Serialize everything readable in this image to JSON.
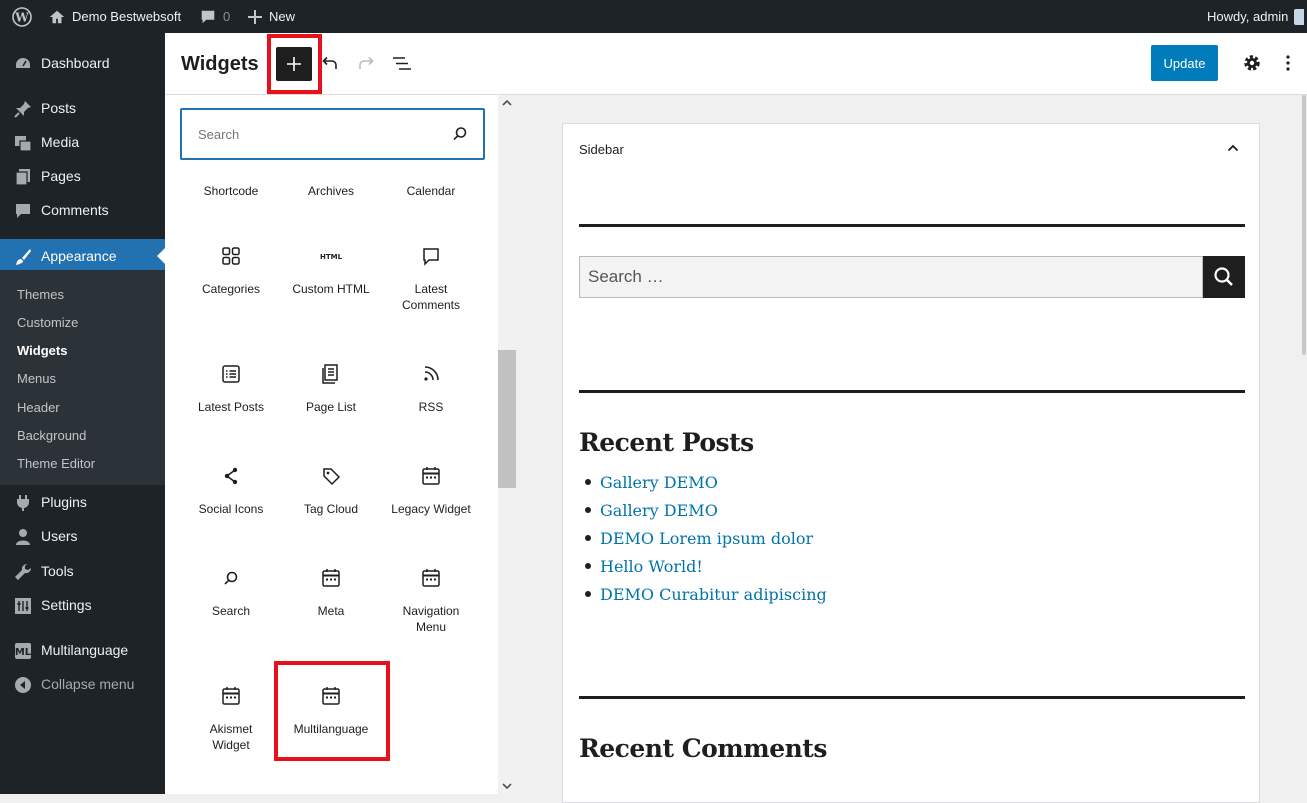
{
  "admin_bar": {
    "site_name": "Demo Bestwebsoft",
    "comments_count": "0",
    "new_label": "New",
    "greeting": "Howdy, admin"
  },
  "sidebar": {
    "items": [
      {
        "key": "dashboard",
        "label": "Dashboard",
        "icon": "dashboard-icon"
      },
      {
        "key": "posts",
        "label": "Posts",
        "icon": "pushpin-icon"
      },
      {
        "key": "media",
        "label": "Media",
        "icon": "media-icon"
      },
      {
        "key": "pages",
        "label": "Pages",
        "icon": "pages-icon"
      },
      {
        "key": "comments",
        "label": "Comments",
        "icon": "comments-icon"
      },
      {
        "key": "appearance",
        "label": "Appearance",
        "icon": "paintbrush-icon"
      },
      {
        "key": "plugins",
        "label": "Plugins",
        "icon": "plugins-icon"
      },
      {
        "key": "users",
        "label": "Users",
        "icon": "users-icon"
      },
      {
        "key": "tools",
        "label": "Tools",
        "icon": "wrench-icon"
      },
      {
        "key": "settings",
        "label": "Settings",
        "icon": "settings-icon"
      },
      {
        "key": "multilanguage",
        "label": "Multilanguage",
        "icon": "multilanguage-icon"
      },
      {
        "key": "collapse",
        "label": "Collapse menu",
        "icon": "collapse-icon"
      }
    ],
    "submenu": [
      "Themes",
      "Customize",
      "Widgets",
      "Menus",
      "Header",
      "Background",
      "Theme Editor"
    ],
    "active": "Appearance",
    "current_submenu": "Widgets"
  },
  "header": {
    "title": "Widgets",
    "update_label": "Update"
  },
  "inserter": {
    "search_placeholder": "Search",
    "blocks": [
      {
        "label": "Shortcode"
      },
      {
        "label": "Archives"
      },
      {
        "label": "Calendar"
      },
      {
        "label": "Categories",
        "icon": "grid-icon"
      },
      {
        "label": "Custom HTML",
        "icon": "html-icon",
        "icon_text": "HTML"
      },
      {
        "label": "Latest Comments",
        "icon": "comment-icon"
      },
      {
        "label": "Latest Posts",
        "icon": "post-list-icon"
      },
      {
        "label": "Page List",
        "icon": "page-list-icon"
      },
      {
        "label": "RSS",
        "icon": "rss-icon"
      },
      {
        "label": "Social Icons",
        "icon": "share-icon"
      },
      {
        "label": "Tag Cloud",
        "icon": "tag-icon"
      },
      {
        "label": "Legacy Widget",
        "icon": "calendar-icon"
      },
      {
        "label": "Search",
        "icon": "search-icon"
      },
      {
        "label": "Meta",
        "icon": "calendar-icon"
      },
      {
        "label": "Navigation Menu",
        "icon": "calendar-icon"
      },
      {
        "label": "Akismet Widget",
        "icon": "calendar-icon"
      },
      {
        "label": "Multilanguage",
        "icon": "calendar-icon"
      }
    ]
  },
  "content": {
    "sidebar_title": "Sidebar",
    "search_placeholder": "Search …",
    "recent_posts_heading": "Recent Posts",
    "recent_posts": [
      "Gallery DEMO",
      "Gallery DEMO",
      "DEMO Lorem ipsum dolor",
      "Hello World!",
      "DEMO Curabitur adipiscing"
    ],
    "recent_comments_heading": "Recent Comments"
  },
  "colors": {
    "admin_dark": "#1d2327",
    "accent_blue": "#2271b1",
    "update_blue": "#007cba",
    "highlight_red": "#e8101b",
    "link_blue": "#0073aa"
  }
}
